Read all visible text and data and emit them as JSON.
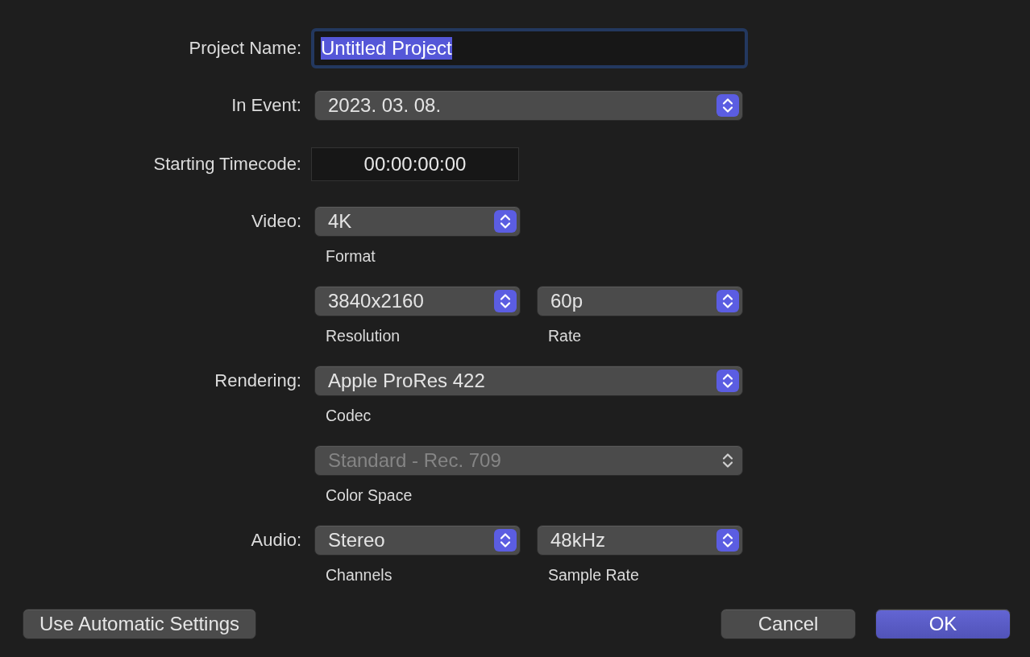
{
  "rows": [
    {
      "label": "Project Name:",
      "controls": [
        {
          "kind": "text",
          "value": "Untitled Project",
          "focused": true
        }
      ]
    },
    {
      "label": "In Event:",
      "controls": [
        {
          "kind": "popup",
          "value": "2023. 03. 08.",
          "disabled": false
        }
      ]
    },
    {
      "label": "Starting Timecode:",
      "controls": [
        {
          "kind": "timecode",
          "value": "00:00:00:00"
        }
      ]
    },
    {
      "label": "Video:",
      "controls": [
        {
          "kind": "popup",
          "value": "4K",
          "caption": "Format",
          "disabled": false
        }
      ]
    },
    {
      "controls": [
        {
          "kind": "popup",
          "value": "3840x2160",
          "caption": "Resolution",
          "disabled": false
        },
        {
          "kind": "popup",
          "value": "60p",
          "caption": "Rate",
          "disabled": false
        }
      ]
    },
    {
      "label": "Rendering:",
      "controls": [
        {
          "kind": "popup",
          "value": "Apple ProRes 422",
          "caption": "Codec",
          "disabled": false
        }
      ]
    },
    {
      "controls": [
        {
          "kind": "popup",
          "value": "Standard - Rec. 709",
          "caption": "Color Space",
          "disabled": true
        }
      ]
    },
    {
      "label": "Audio:",
      "controls": [
        {
          "kind": "popup",
          "value": "Stereo",
          "caption": "Channels",
          "disabled": false
        },
        {
          "kind": "popup",
          "value": "48kHz",
          "caption": "Sample Rate",
          "disabled": false
        }
      ]
    }
  ],
  "buttons": [
    {
      "label": "Use Automatic Settings",
      "default": false
    },
    {
      "label": "Cancel",
      "default": false
    },
    {
      "label": "OK",
      "default": true
    }
  ]
}
